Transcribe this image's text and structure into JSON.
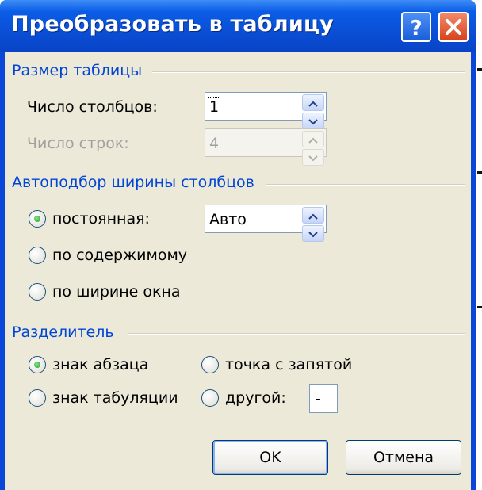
{
  "dialog": {
    "title": "Преобразовать в таблицу",
    "help_icon": "question-mark-icon",
    "close_icon": "close-x-icon"
  },
  "table_size": {
    "section_title": "Размер таблицы",
    "columns_label": "Число столбцов:",
    "columns_value": "1",
    "rows_label": "Число строк:",
    "rows_value": "4"
  },
  "autofit": {
    "section_title": "Автоподбор ширины столбцов",
    "fixed_label": "постоянная:",
    "fixed_value": "Авто",
    "content_label": "по содержимому",
    "window_label": "по ширине окна",
    "selected": "fixed"
  },
  "separator": {
    "section_title": "Разделитель",
    "paragraph_label": "знак абзаца",
    "semicolon_label": "точка с запятой",
    "tab_label": "знак табуляции",
    "other_label": "другой:",
    "other_value": "-",
    "selected": "paragraph"
  },
  "buttons": {
    "ok_label": "OK",
    "cancel_label": "Отмена"
  },
  "colors": {
    "title_bar": "#0a4fd6",
    "section_title": "#0046d5",
    "dialog_face": "#ece9d8",
    "close_button": "#d8401c"
  }
}
